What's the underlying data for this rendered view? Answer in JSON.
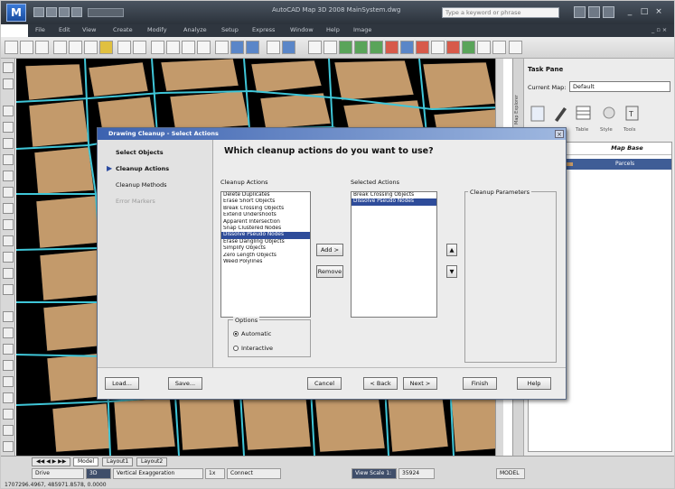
{
  "app": {
    "title": "AutoCAD Map 3D 2008   MainSystem.dwg",
    "search_placeholder": "Type a keyword or phrase",
    "workspace": ""
  },
  "menu": [
    "File",
    "Edit",
    "View",
    "Create",
    "Modify",
    "Analyze",
    "Setup",
    "Express",
    "Window",
    "Help",
    "Image"
  ],
  "task_pane": {
    "title": "Task Pane",
    "current_map_label": "Current Map:",
    "current_map_value": "Default",
    "tools": [
      "Table",
      "Style",
      "Tools"
    ],
    "map_base_header": "Map Base",
    "layer_name": "Parcels",
    "side_label": "Map Explorer"
  },
  "dialog": {
    "title": "Drawing Cleanup - Select Actions",
    "heading": "Which cleanup actions do you want to use?",
    "steps": [
      {
        "label": "Select Objects",
        "state": "done"
      },
      {
        "label": "Cleanup Actions",
        "state": "current"
      },
      {
        "label": "Cleanup Methods",
        "state": "pending"
      },
      {
        "label": "Error Markers",
        "state": "disabled"
      }
    ],
    "cleanup_actions_label": "Cleanup Actions",
    "cleanup_actions": [
      "Delete Duplicates",
      "Erase Short Objects",
      "Break Crossing Objects",
      "Extend Undershoots",
      "Apparent Intersection",
      "Snap Clustered Nodes",
      "Dissolve Pseudo Nodes",
      "Erase Dangling Objects",
      "Simplify Objects",
      "Zero Length Objects",
      "Weed Polylines"
    ],
    "cleanup_actions_selected_index": 6,
    "selected_actions_label": "Selected Actions",
    "selected_actions": [
      "Break Crossing Objects",
      "Dissolve Pseudo Nodes"
    ],
    "selected_actions_highlight_index": 1,
    "cleanup_parameters_label": "Cleanup Parameters",
    "add_label": "Add >",
    "remove_label": "Remove",
    "options_label": "Options",
    "option_automatic": "Automatic",
    "option_interactive": "Interactive",
    "option_selected": "automatic",
    "buttons": {
      "load": "Load...",
      "save": "Save...",
      "cancel": "Cancel",
      "back": "< Back",
      "next": "Next >",
      "finish": "Finish",
      "help": "Help"
    }
  },
  "status": {
    "tabs": [
      "Model",
      "Layout1",
      "Layout2"
    ],
    "active_tab": "Model",
    "cells": [
      "Drive",
      "3D",
      "Vertical Exaggeration",
      "1x",
      "Connect"
    ],
    "view_scale_label": "View Scale 1:",
    "view_scale_value": "35924",
    "model_label": "MODEL",
    "coordinates": "1707296.4967, 485971.8578, 0.0000"
  }
}
